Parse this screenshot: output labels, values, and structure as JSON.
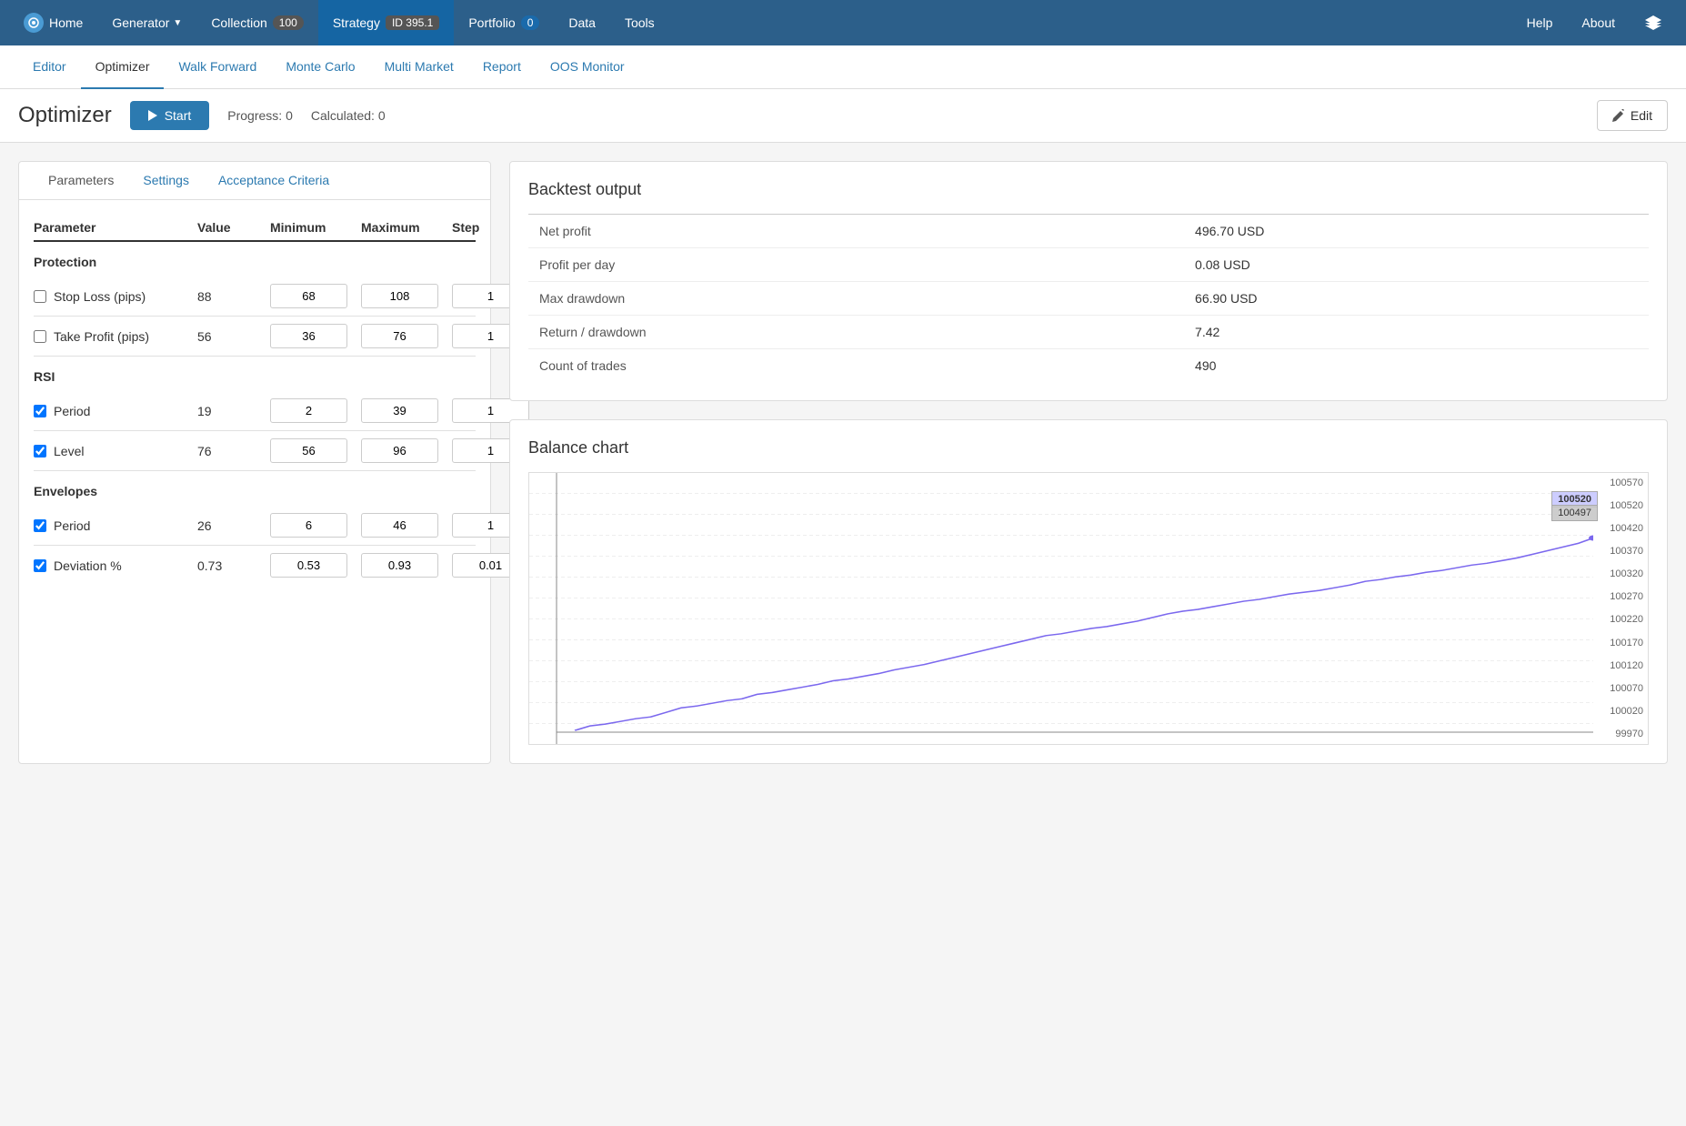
{
  "topNav": {
    "home": "Home",
    "generator": "Generator",
    "collection": "Collection",
    "collectionBadge": "100",
    "strategy": "Strategy",
    "strategyBadge": "ID 395.1",
    "portfolio": "Portfolio",
    "portfolioBadge": "0",
    "data": "Data",
    "tools": "Tools",
    "help": "Help",
    "about": "About"
  },
  "subNav": {
    "tabs": [
      "Editor",
      "Optimizer",
      "Walk Forward",
      "Monte Carlo",
      "Multi Market",
      "Report",
      "OOS Monitor"
    ],
    "activeTab": "Optimizer"
  },
  "pageHeader": {
    "title": "Optimizer",
    "startBtn": "Start",
    "progressLabel": "Progress:",
    "progressValue": "0",
    "calculatedLabel": "Calculated:",
    "calculatedValue": "0",
    "editBtn": "Edit"
  },
  "leftPanel": {
    "tabs": [
      "Parameters",
      "Settings",
      "Acceptance Criteria"
    ],
    "activeTab": "Parameters",
    "tableHeaders": {
      "parameter": "Parameter",
      "value": "Value",
      "minimum": "Minimum",
      "maximum": "Maximum",
      "step": "Step"
    },
    "sections": [
      {
        "name": "Protection",
        "rows": [
          {
            "label": "Stop Loss (pips)",
            "checked": false,
            "value": "88",
            "min": "68",
            "max": "108",
            "step": "1"
          },
          {
            "label": "Take Profit (pips)",
            "checked": false,
            "value": "56",
            "min": "36",
            "max": "76",
            "step": "1"
          }
        ]
      },
      {
        "name": "RSI",
        "rows": [
          {
            "label": "Period",
            "checked": true,
            "value": "19",
            "min": "2",
            "max": "39",
            "step": "1"
          },
          {
            "label": "Level",
            "checked": true,
            "value": "76",
            "min": "56",
            "max": "96",
            "step": "1"
          }
        ]
      },
      {
        "name": "Envelopes",
        "rows": [
          {
            "label": "Period",
            "checked": true,
            "value": "26",
            "min": "6",
            "max": "46",
            "step": "1"
          },
          {
            "label": "Deviation %",
            "checked": true,
            "value": "0.73",
            "min": "0.53",
            "max": "0.93",
            "step": "0.01"
          }
        ]
      }
    ]
  },
  "backtest": {
    "title": "Backtest output",
    "rows": [
      {
        "label": "Net profit",
        "value": "496.70 USD"
      },
      {
        "label": "Profit per day",
        "value": "0.08 USD"
      },
      {
        "label": "Max drawdown",
        "value": "66.90 USD"
      },
      {
        "label": "Return / drawdown",
        "value": "7.42"
      },
      {
        "label": "Count of trades",
        "value": "490"
      }
    ]
  },
  "chart": {
    "title": "Balance chart",
    "labels": [
      "100570",
      "100520",
      "100497",
      "100420",
      "100370",
      "100320",
      "100270",
      "100220",
      "100170",
      "100120",
      "100070",
      "100020",
      "99970"
    ],
    "tooltip1": "100520",
    "tooltip2": "100497"
  }
}
